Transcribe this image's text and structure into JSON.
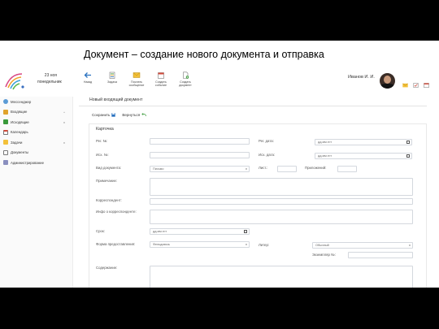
{
  "slide_title": "Документ – создание нового документа и отправка",
  "header": {
    "date": "23 ноя понедельник",
    "user_name": "Иванов И. И.",
    "toolbar": [
      {
        "label": "Назад",
        "icon": "back-arrow-icon"
      },
      {
        "label": "Задача",
        "icon": "task-icon"
      },
      {
        "label": "Послать сообщение",
        "icon": "message-icon"
      },
      {
        "label": "Создать событие",
        "icon": "calendar-icon"
      },
      {
        "label": "Создать документ",
        "icon": "document-icon"
      }
    ]
  },
  "sidebar": {
    "items": [
      {
        "label": "Мессенджер"
      },
      {
        "label": "Входящие"
      },
      {
        "label": "Исходящие"
      },
      {
        "label": "Календарь"
      },
      {
        "label": "Задачи"
      },
      {
        "label": "Документы"
      },
      {
        "label": "Администрирование"
      }
    ]
  },
  "main": {
    "page_heading": "Новый входящий документ",
    "save_label": "Сохранить",
    "back_label": "Вернуться",
    "card_title": "Карточка"
  },
  "form": {
    "reg_no_label": "Рег. №:",
    "reg_date_label": "Рег. дата:",
    "ref_no_label": "Исх. №:",
    "ref_date_label": "Исх. дата:",
    "date_placeholder": "дд.мм.гггг",
    "doc_type_label": "Вид документа:",
    "doc_type_value": "Письмо",
    "sheets_label": "Лист.:",
    "attachments_label": "Приложений:",
    "note_label": "Примечание:",
    "correspondent_label": "Корреспондент:",
    "addressee_label": "Инфо о корреспонденте:",
    "deadline_label": "Срок:",
    "delivery_label": "Форма предоставления:",
    "delivery_value": "Фельдсвязь",
    "stamp_label": "Литер:",
    "stamp_value": "Обычный",
    "copy_no_label": "Экземпляр №:",
    "content_label": "Содержание:"
  },
  "colors": {
    "accent": "#2a72c0",
    "green": "#3a9a3a",
    "gold": "#e0a32c",
    "red": "#d24a3a"
  }
}
